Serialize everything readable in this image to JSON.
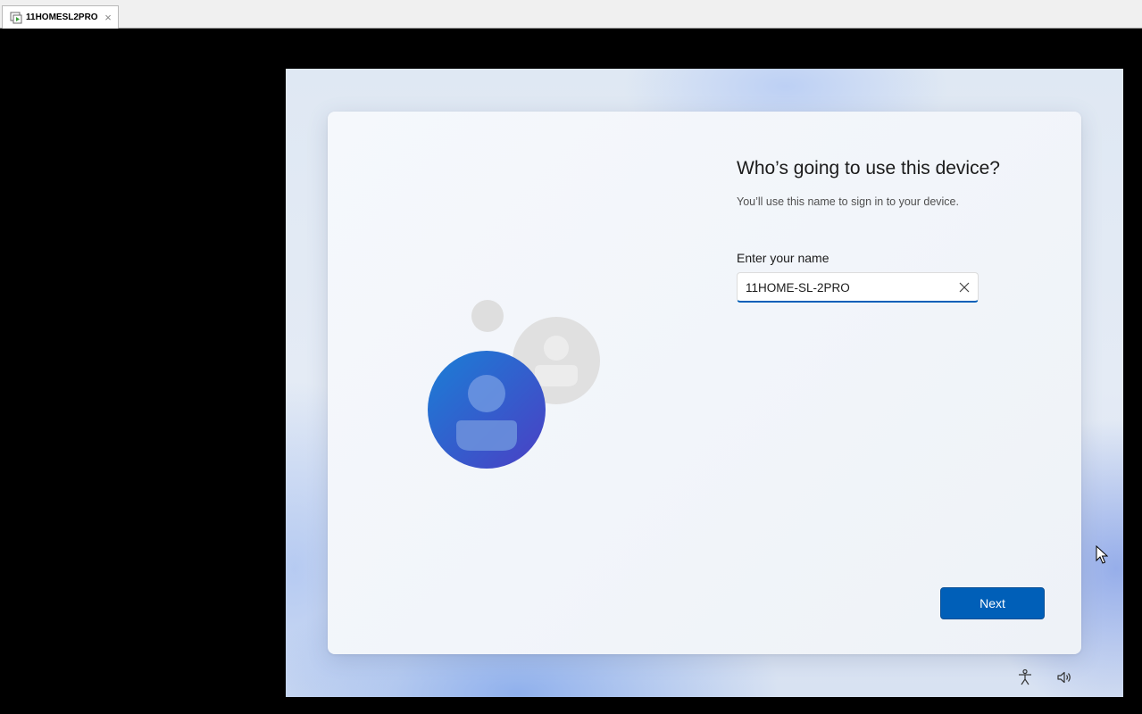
{
  "window": {
    "tab_title": "11HOMESL2PRO",
    "tab_icon": "vm-console-icon",
    "close_glyph": "×"
  },
  "oobe": {
    "heading": "Who’s going to use this device?",
    "subtext": "You’ll use this name to sign in to your device.",
    "name_label": "Enter your name",
    "name_value": "11HOME-SL-2PRO",
    "next_label": "Next"
  },
  "footer_icons": [
    "accessibility-icon",
    "volume-icon"
  ],
  "colors": {
    "accent": "#005fb8",
    "avatar_primary": "#1f6fd0",
    "avatar_secondary": "#dcdcdc"
  }
}
